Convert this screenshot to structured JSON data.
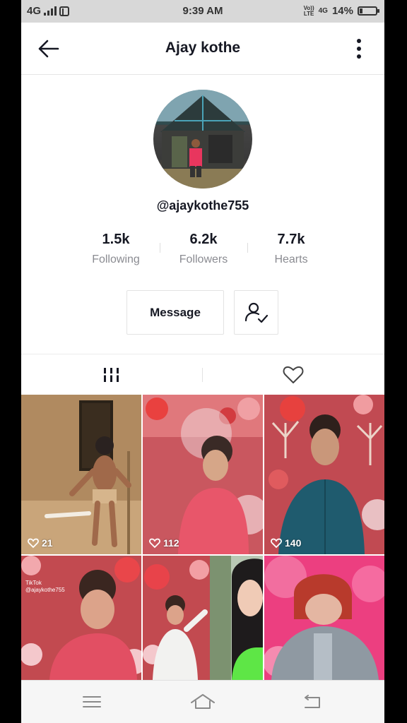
{
  "status_bar": {
    "network": "4G",
    "time": "9:39 AM",
    "volte_top": "Vo))",
    "volte_bottom": "LTE",
    "net2": "4G",
    "battery": "14%"
  },
  "header": {
    "title": "Ajay kothe",
    "back_icon": "arrow-left-icon",
    "more_icon": "more-vertical-icon"
  },
  "profile": {
    "handle": "@ajaykothe755",
    "stats": [
      {
        "value": "1.5k",
        "label": "Following"
      },
      {
        "value": "6.2k",
        "label": "Followers"
      },
      {
        "value": "7.7k",
        "label": "Hearts"
      }
    ],
    "message_label": "Message",
    "follow_icon": "person-check-icon"
  },
  "tabs": [
    {
      "icon": "grid-bars-icon",
      "active": true
    },
    {
      "icon": "heart-outline-icon",
      "active": false
    }
  ],
  "videos": [
    {
      "likes": "21"
    },
    {
      "likes": "112"
    },
    {
      "likes": "140"
    },
    {
      "likes": ""
    },
    {
      "likes": ""
    },
    {
      "likes": ""
    }
  ],
  "thumb_watermark": {
    "app": "TikTok",
    "handle": "@ajaykothe755"
  },
  "nav_bar": [
    "menu-icon",
    "home-icon",
    "back-icon"
  ],
  "colors": {
    "text": "#161823",
    "muted": "#8a8b91",
    "border": "#e3e3e3"
  }
}
